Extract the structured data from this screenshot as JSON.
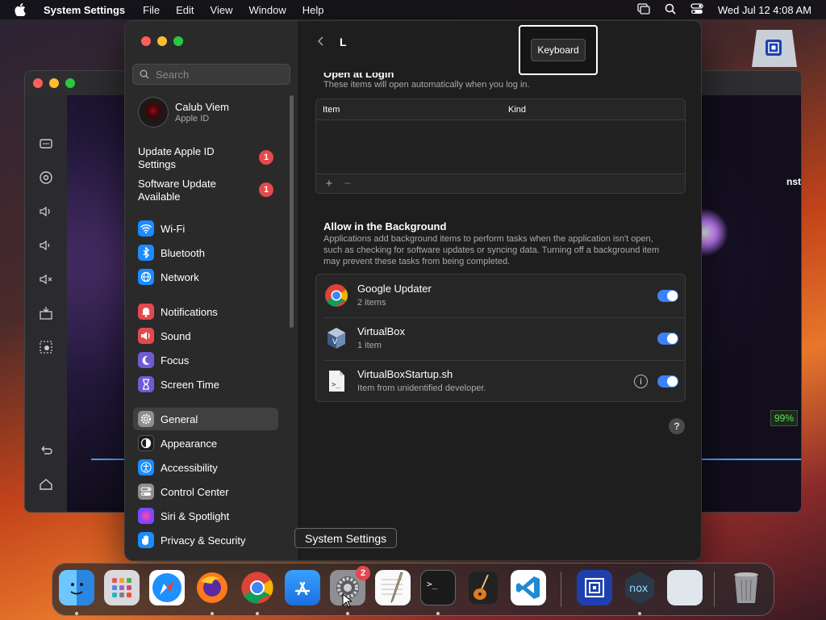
{
  "menubar": {
    "app_name": "System Settings",
    "items": [
      "File",
      "Edit",
      "View",
      "Window",
      "Help"
    ],
    "clock": "Wed Jul 12  4:08 AM"
  },
  "background_window": {
    "percent_badge": "99%",
    "partial_text": "nst"
  },
  "sidebar": {
    "search_placeholder": "Search",
    "account": {
      "name": "Calub Viem",
      "subtitle": "Apple ID"
    },
    "updates": [
      {
        "label_line1": "Update Apple ID",
        "label_line2": "Settings",
        "badge": "1"
      },
      {
        "label_line1": "Software Update",
        "label_line2": "Available",
        "badge": "1"
      }
    ],
    "items": [
      {
        "label": "Wi-Fi",
        "icon": "wifi-icon",
        "color": "#1a8cff"
      },
      {
        "label": "Bluetooth",
        "icon": "bluetooth-icon",
        "color": "#1a8cff"
      },
      {
        "label": "Network",
        "icon": "globe-icon",
        "color": "#1a8cff"
      },
      {
        "label": "Notifications",
        "icon": "bell-icon",
        "color": "#e5484d"
      },
      {
        "label": "Sound",
        "icon": "speaker-icon",
        "color": "#e5484d"
      },
      {
        "label": "Focus",
        "icon": "moon-icon",
        "color": "#6e5bd6"
      },
      {
        "label": "Screen Time",
        "icon": "hourglass-icon",
        "color": "#6e5bd6"
      },
      {
        "label": "General",
        "icon": "gear-icon",
        "color": "#8e8e93",
        "active": true
      },
      {
        "label": "Appearance",
        "icon": "appearance-icon",
        "color": "#1c1c1e"
      },
      {
        "label": "Accessibility",
        "icon": "accessibility-icon",
        "color": "#1a8cff"
      },
      {
        "label": "Control Center",
        "icon": "control-center-icon",
        "color": "#8e8e93"
      },
      {
        "label": "Siri & Spotlight",
        "icon": "siri-icon",
        "color": "#c040c0"
      },
      {
        "label": "Privacy & Security",
        "icon": "hand-icon",
        "color": "#1a8cff"
      }
    ]
  },
  "main": {
    "title_fragment": "L",
    "tooltip": "Keyboard",
    "open_at_login": {
      "heading": "Open at Login",
      "description": "These items will open automatically when you log in.",
      "columns": [
        "Item",
        "Kind"
      ],
      "add": "+",
      "remove": "−"
    },
    "background": {
      "heading": "Allow in the Background",
      "description": "Applications add background items to perform tasks when the application isn't open, such as checking for software updates or syncing data. Turning off a background item may prevent these tasks from being completed.",
      "items": [
        {
          "name": "Google Updater",
          "detail": "2 items",
          "icon": "chrome-icon",
          "enabled": true
        },
        {
          "name": "VirtualBox",
          "detail": "1 item",
          "icon": "virtualbox-icon",
          "enabled": true
        },
        {
          "name": "VirtualBoxStartup.sh",
          "detail": "Item from unidentified developer.",
          "icon": "script-file-icon",
          "enabled": true,
          "info": "i"
        }
      ]
    },
    "help": "?"
  },
  "dock": {
    "tooltip": "System Settings",
    "settings_badge": "2",
    "apps": [
      "finder-icon",
      "launchpad-icon",
      "safari-icon",
      "firefox-icon",
      "chrome-icon",
      "app-store-icon",
      "system-settings-icon",
      "textedit-icon",
      "terminal-icon",
      "garageband-icon",
      "vscode-icon",
      "virtualbox-app-icon",
      "nox-icon",
      "preview-icon",
      "trash-icon"
    ]
  }
}
